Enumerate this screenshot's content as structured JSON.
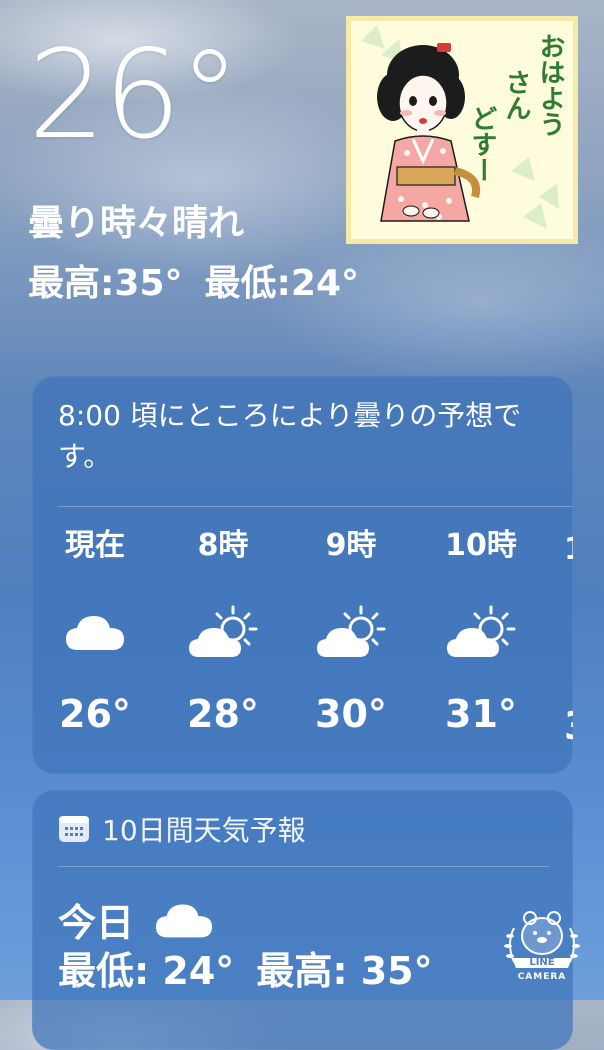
{
  "current": {
    "temperature": "26°",
    "condition": "曇り時々晴れ",
    "high": "最高:35°",
    "low": "最低:24°"
  },
  "sticker": {
    "text_line1": "おはよう",
    "text_line2": "さん",
    "text_line3": "どすー"
  },
  "hourly_forecast": {
    "summary": "8:00 頃にところにより曇りの予想です。",
    "hours": [
      {
        "label": "現在",
        "icon": "cloud-icon",
        "temp": "26°"
      },
      {
        "label": "8時",
        "icon": "partly-sunny-icon",
        "temp": "28°"
      },
      {
        "label": "9時",
        "icon": "partly-sunny-icon",
        "temp": "30°"
      },
      {
        "label": "10時",
        "icon": "partly-sunny-icon",
        "temp": "31°"
      }
    ],
    "partial_next_label": "1",
    "partial_next_temp": "3"
  },
  "ten_day": {
    "header": "10日間天気予報",
    "today_label": "今日",
    "today_icon": "cloud-icon",
    "today_low": "最低: 24°",
    "today_high": "最高: 35°"
  },
  "watermark": {
    "brand_line1": "LINE",
    "brand_line2": "CAMERA"
  }
}
